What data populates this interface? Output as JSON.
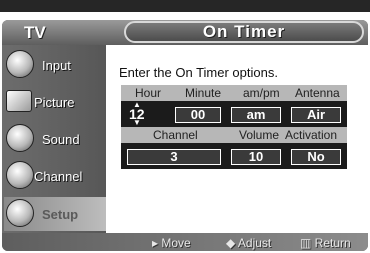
{
  "header": {
    "tv_label": "TV",
    "title": "On Timer"
  },
  "sidebar": {
    "items": [
      {
        "label": "Input",
        "icon": "input-icon"
      },
      {
        "label": "Picture",
        "icon": "picture-icon"
      },
      {
        "label": "Sound",
        "icon": "sound-icon"
      },
      {
        "label": "Channel",
        "icon": "channel-icon"
      },
      {
        "label": "Setup",
        "icon": "setup-icon",
        "selected": true
      }
    ]
  },
  "main": {
    "instruction": "Enter the On Timer options.",
    "row1": {
      "labels": [
        "Hour",
        "Minute",
        "am/pm",
        "Antenna"
      ],
      "values": {
        "hour": "12",
        "minute": "00",
        "ampm": "am",
        "antenna": "Air"
      }
    },
    "row2": {
      "labels": [
        "Channel",
        "Volume",
        "Activation"
      ],
      "values": {
        "channel": "3",
        "volume": "10",
        "activation": "No"
      }
    }
  },
  "footer": {
    "move": "Move",
    "adjust": "Adjust",
    "return": "Return"
  }
}
